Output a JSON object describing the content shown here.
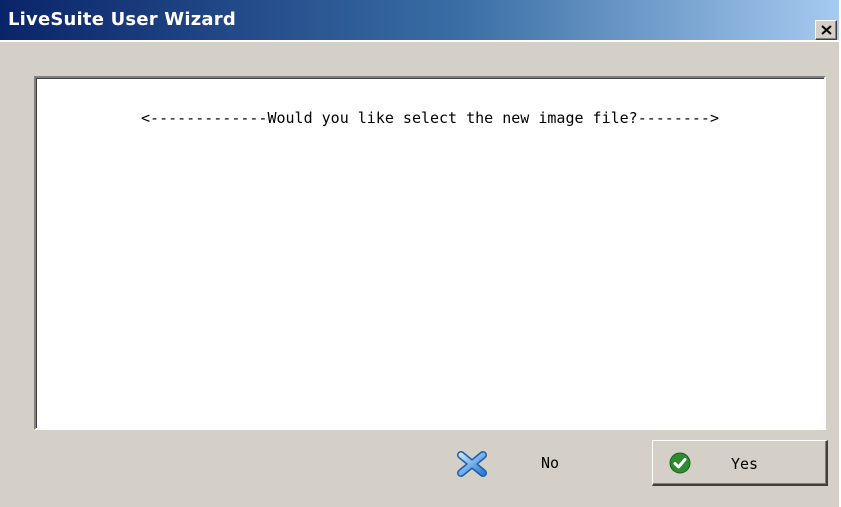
{
  "window": {
    "title": "LiveSuite User Wizard",
    "close_glyph": "×"
  },
  "content": {
    "message": "<-------------Would you like select the new image file?-------->"
  },
  "buttons": {
    "no_label": "No",
    "yes_label": "Yes",
    "no_icon": "x-icon",
    "yes_icon": "check-icon"
  },
  "colors": {
    "title_bar_start": "#0a246a",
    "title_bar_end": "#a6caf0",
    "dialog_bg": "#d4d0c8",
    "no_icon_color": "#4a90e2",
    "yes_icon_color": "#2e8b2e"
  }
}
